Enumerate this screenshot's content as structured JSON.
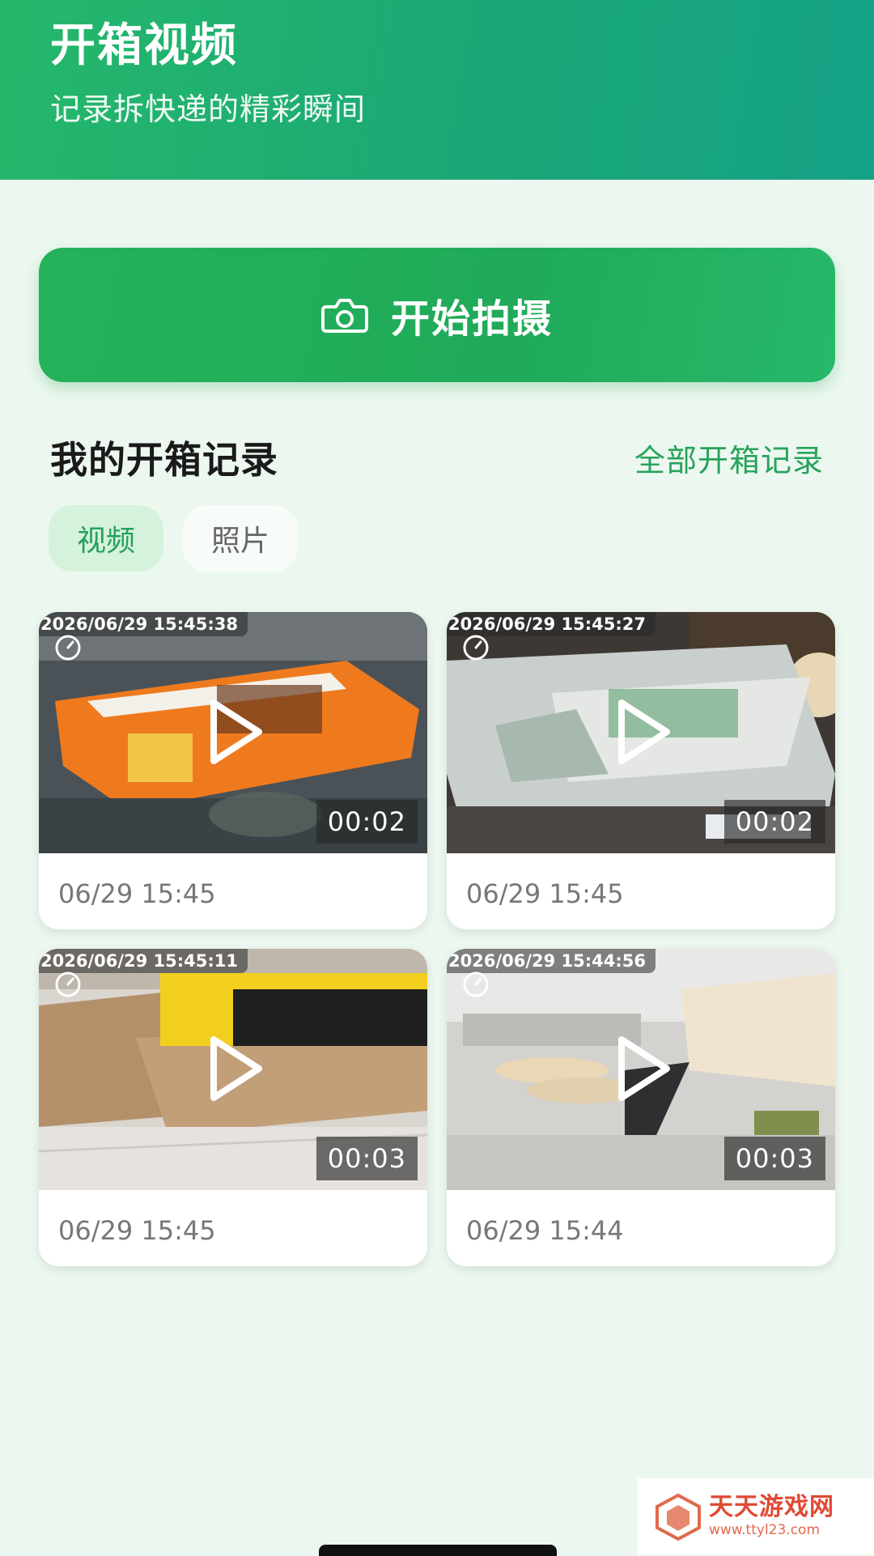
{
  "header": {
    "title": "开箱视频",
    "subtitle": "记录拆快递的精彩瞬间"
  },
  "start_button": {
    "label": "开始拍摄",
    "icon": "camera-icon"
  },
  "section": {
    "title": "我的开箱记录",
    "link": "全部开箱记录"
  },
  "tabs": [
    {
      "label": "视频",
      "active": true
    },
    {
      "label": "照片",
      "active": false
    }
  ],
  "videos": [
    {
      "stamp": "2026/06/29 15:45:38",
      "duration": "00:02",
      "date": "06/29 15:45"
    },
    {
      "stamp": "2026/06/29 15:45:27",
      "duration": "00:02",
      "date": "06/29 15:45"
    },
    {
      "stamp": "2026/06/29 15:45:11",
      "duration": "00:03",
      "date": "06/29 15:45"
    },
    {
      "stamp": "2026/06/29 15:44:56",
      "duration": "00:03",
      "date": "06/29 15:44"
    }
  ],
  "watermark": {
    "name": "天天游戏网",
    "url": "www.ttyl23.com"
  },
  "colors": {
    "header_gradient": [
      "#25b86a",
      "#15a186"
    ],
    "accent": "#27a35c",
    "page_background": "#ecf8ef"
  }
}
